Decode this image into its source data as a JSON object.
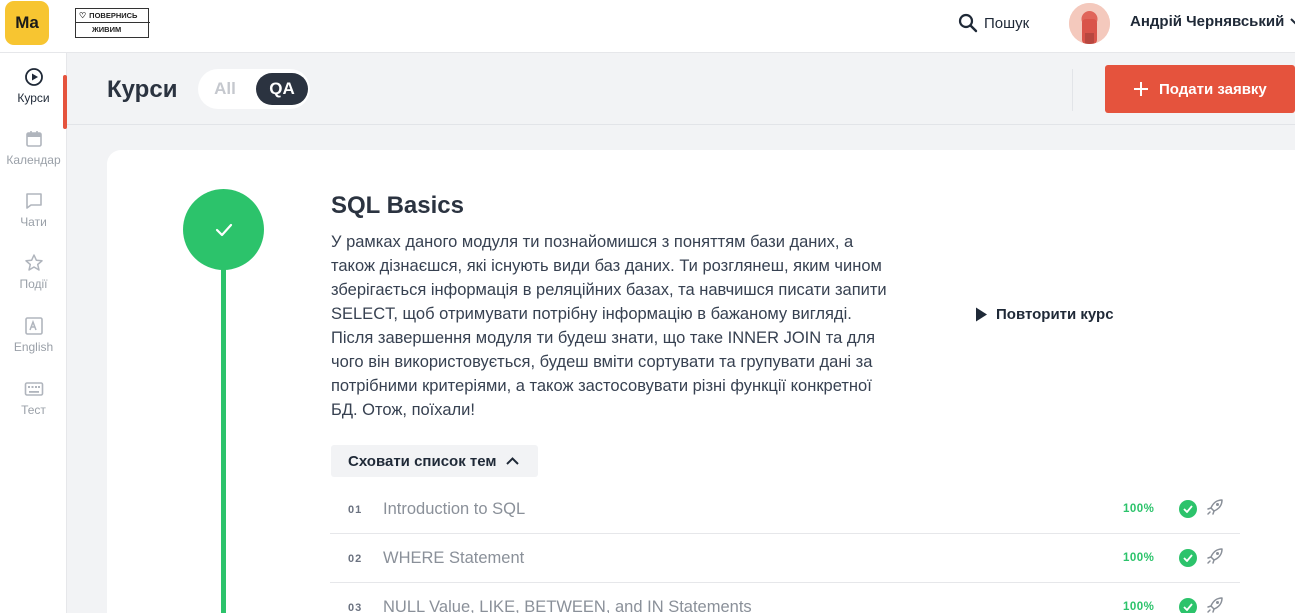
{
  "header": {
    "logo_text": "Ma",
    "partner_logo": {
      "line1": "ПОВЕРНИСЬ",
      "line2": "ЖИВИМ"
    },
    "search_label": "Пошук",
    "user_name": "Андрій Чернявський"
  },
  "sidebar": {
    "items": [
      {
        "label": "Курси",
        "icon": "play-circle-icon",
        "active": true
      },
      {
        "label": "Календар",
        "icon": "calendar-icon",
        "active": false
      },
      {
        "label": "Чати",
        "icon": "chat-icon",
        "active": false
      },
      {
        "label": "Події",
        "icon": "star-icon",
        "active": false
      },
      {
        "label": "English",
        "icon": "translate-icon",
        "active": false
      },
      {
        "label": "Тест",
        "icon": "keyboard-icon",
        "active": false
      }
    ]
  },
  "page": {
    "title": "Курси",
    "filters": [
      "All",
      "QA"
    ],
    "selected_filter": "QA",
    "apply_button": "Подати заявку"
  },
  "course": {
    "title": "SQL Basics",
    "description": "У рамках даного модуля ти познайомишся з поняттям бази даних, а також дізнаєшся, які існують види баз даних. Ти розглянеш, яким чином зберігається інформація в реляційних базах, та навчишся писати запити SELECT, щоб отримувати потрібну інформацію в бажаному вигляді. Після завершення модуля ти будеш знати, що таке INNER JOIN та для чого він використовується, будеш вміти сортувати та групувати дані за потрібними критеріями, а також застосовувати різні функції конкретної БД. Отож, поїхали!",
    "repeat_button": "Повторити курс",
    "toggle_topics_button": "Сховати список тем",
    "status_color": "#2cc36b",
    "topics": [
      {
        "num": "01",
        "name": "Introduction to SQL",
        "progress": "100%"
      },
      {
        "num": "02",
        "name": "WHERE Statement",
        "progress": "100%"
      },
      {
        "num": "03",
        "name": "NULL Value, LIKE, BETWEEN, and IN Statements",
        "progress": "100%"
      }
    ]
  },
  "colors": {
    "accent": "#e5533d",
    "brand": "#f7c531",
    "success": "#2cc36b",
    "dark": "#2b3340"
  }
}
